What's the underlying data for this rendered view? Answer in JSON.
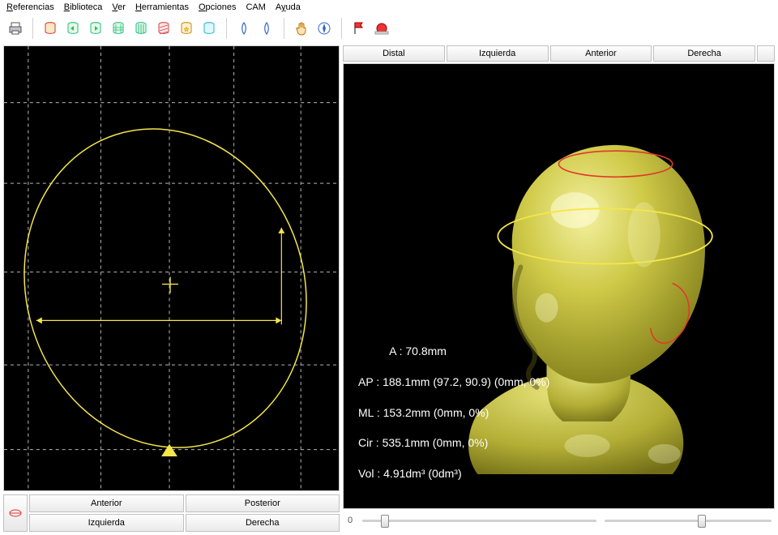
{
  "menu": {
    "items": [
      "Referencias",
      "Biblioteca",
      "Ver",
      "Herramientas",
      "Opciones",
      "CAM",
      "Ayuda"
    ]
  },
  "toolbar": {
    "items": [
      "printer-icon",
      "sep",
      "cylinder-open-icon",
      "cylinder-left-arrow-icon",
      "cylinder-right-arrow-icon",
      "cylinder-grid-icon",
      "cylinder-columns-icon",
      "cylinder-hatched-icon",
      "cylinder-star-icon",
      "cylinder-cyan-icon",
      "sep",
      "outline-blue-icon",
      "outline-blue-alt-icon",
      "sep",
      "hand-cursor-icon",
      "compass-icon",
      "sep",
      "flag-red-icon",
      "record-red-icon"
    ]
  },
  "left_panel": {
    "buttons": {
      "anterior": "Anterior",
      "posterior": "Posterior",
      "izquierda": "Izquierda",
      "derecha": "Derecha"
    }
  },
  "right_panel": {
    "view_buttons": {
      "distal": "Distal",
      "izquierda": "Izquierda",
      "anterior": "Anterior",
      "derecha": "Derecha",
      "extra": ""
    },
    "stats": {
      "a_label": "A :",
      "a_value": "70.8mm",
      "ap_label": "AP :",
      "ap_value": "188.1mm (97.2, 90.9) (0mm, 0%)",
      "ml_label": "ML :",
      "ml_value": "153.2mm (0mm, 0%)",
      "cir_label": "Cir :",
      "cir_value": "535.1mm (0mm, 0%)",
      "vol_label": "Vol :",
      "vol_value": "4.91dm³ (0dm³)"
    },
    "slider": {
      "min_label": "0",
      "value_pos": 0.58,
      "value_pos2": 0.1
    }
  },
  "colors": {
    "model": "#cac63a",
    "ring_yellow": "#f4e64b",
    "ring_red": "#e03a2a",
    "grid": "#9a9a9a"
  }
}
